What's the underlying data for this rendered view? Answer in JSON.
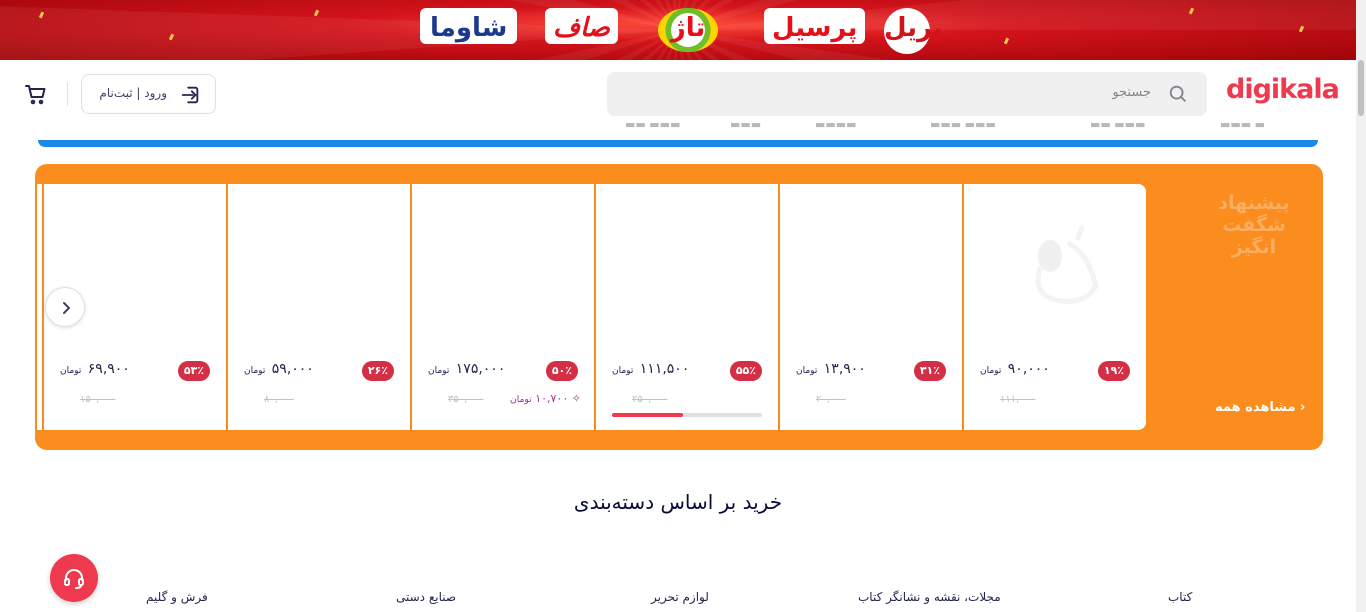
{
  "banner": {
    "brands": [
      "پریل",
      "پرسیل",
      "تاژ",
      "صاف",
      "شاوما"
    ]
  },
  "header": {
    "logo": "digikala",
    "search_placeholder": "جستجو",
    "login_label": "ورود | ثبت‌نام"
  },
  "amazing": {
    "title": "پیشنهاد شگفت انگیز",
    "see_all": "مشاهده همه",
    "currency": "تومان",
    "products": [
      {
        "discount": "۱۹٪",
        "price": "۹۰,۰۰۰",
        "old_price": "۱۱۱,۰۰۰",
        "icon": "headset-icon"
      },
      {
        "discount": "۳۱٪",
        "price": "۱۳,۹۰۰",
        "old_price": "۲۰,۰۰۰"
      },
      {
        "discount": "۵۵٪",
        "price": "۱۱۱,۵۰۰",
        "old_price": "۲۵۰,۰۰۰",
        "sold_fraction": 0.47
      },
      {
        "discount": "۵۰٪",
        "price": "۱۷۵,۰۰۰",
        "old_price": "۳۵۰,۰۰۰",
        "coin": "۱۰,۷۰۰"
      },
      {
        "discount": "۲۶٪",
        "price": "۵۹,۰۰۰",
        "old_price": "۸۰,۰۰۰"
      },
      {
        "discount": "۵۳٪",
        "price": "۶۹,۹۰۰",
        "old_price": "۱۵۰,۰۰۰"
      }
    ]
  },
  "categories": {
    "title": "خرید بر اساس دسته‌بندی",
    "items": [
      "کتاب",
      "مجلات، نقشه و نشانگر کتاب",
      "لوازم تحریر",
      "صنایع دستی",
      "فرش و گلیم"
    ]
  },
  "colors": {
    "brand_red": "#ef394e",
    "amazing_orange": "#fb8c1e",
    "blue_bar": "#1e88e5"
  }
}
